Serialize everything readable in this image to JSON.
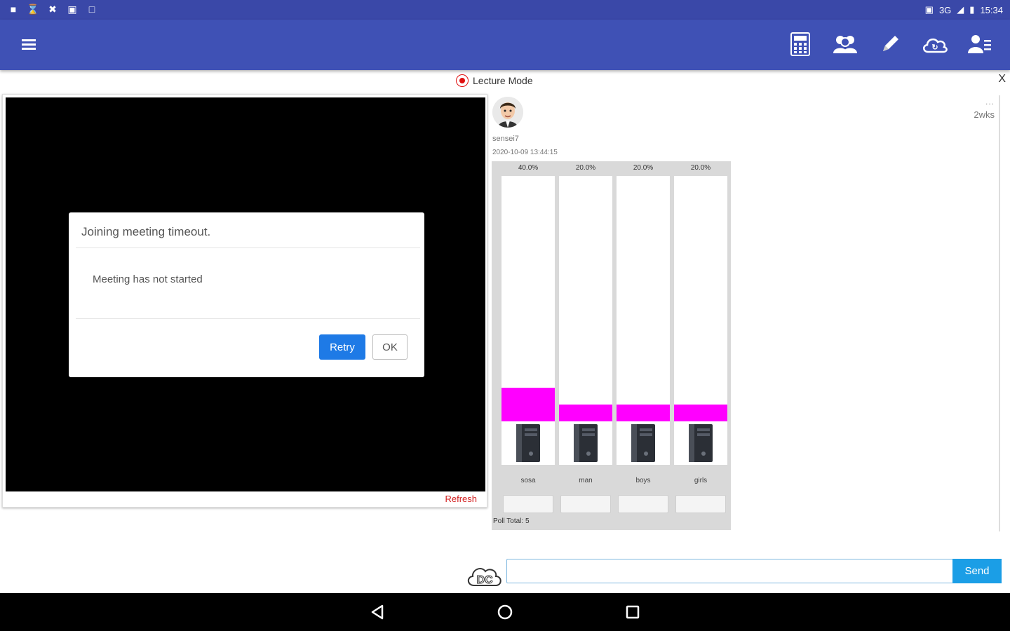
{
  "status_bar": {
    "left_icons": [
      "video-icon",
      "hourglass-icon",
      "tools-icon",
      "lock-icon",
      "square-icon"
    ],
    "network": "3G",
    "time": "15:34"
  },
  "toolbar": {
    "icons": [
      "calculator-icon",
      "group-icon",
      "pencil-icon",
      "cloud-sync-icon",
      "user-settings-icon"
    ]
  },
  "mode": {
    "label": "Lecture Mode",
    "close_label": "X"
  },
  "video_panel": {
    "refresh_label": "Refresh",
    "dialog": {
      "title": "Joining meeting timeout.",
      "message": "Meeting has not started",
      "retry_label": "Retry",
      "ok_label": "OK"
    }
  },
  "post": {
    "username": "sensei7",
    "timestamp": "2020-10-09 13:44:15",
    "menu_label": "...",
    "age": "2wks",
    "poll": {
      "options": [
        {
          "label": "sosa",
          "percent_label": "40.0%",
          "fraction": 0.4
        },
        {
          "label": "man",
          "percent_label": "20.0%",
          "fraction": 0.2
        },
        {
          "label": "boys",
          "percent_label": "20.0%",
          "fraction": 0.2
        },
        {
          "label": "girls",
          "percent_label": "20.0%",
          "fraction": 0.2
        }
      ],
      "total_label": "Poll Total: 5",
      "bar_color": "#ff00ff"
    }
  },
  "chat_input": {
    "logo_text": "DC",
    "placeholder": "",
    "send_label": "Send"
  },
  "nav_bar": {
    "buttons": [
      "back-icon",
      "home-icon",
      "recents-icon"
    ]
  }
}
